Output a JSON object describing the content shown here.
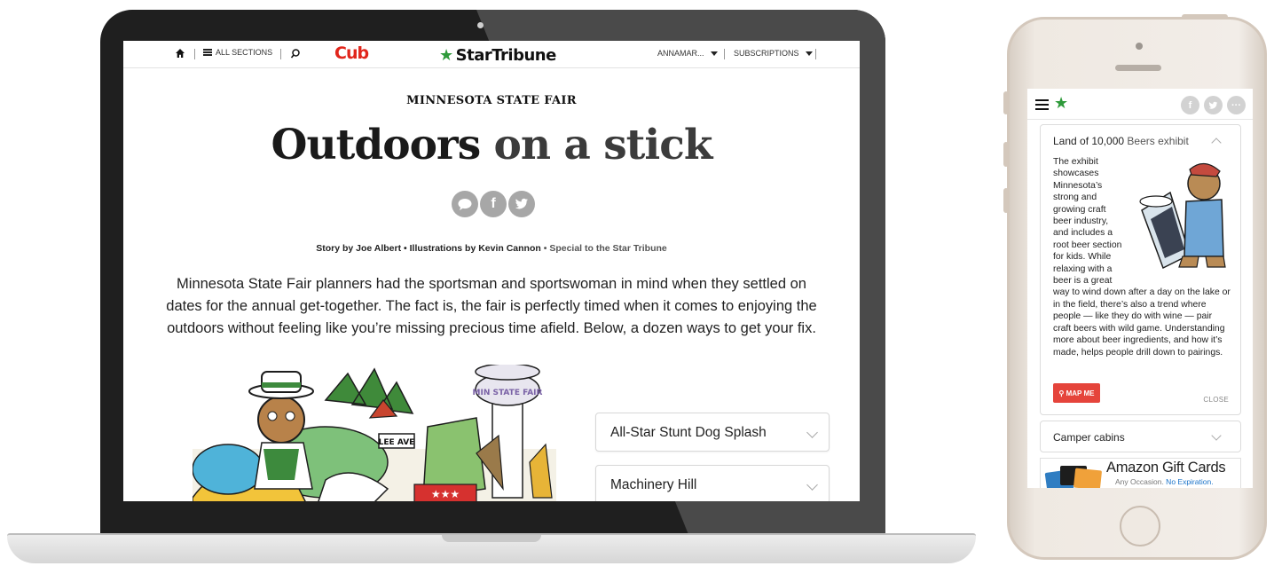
{
  "desktop": {
    "topbar": {
      "all_sections": "ALL SECTIONS",
      "sponsor": "Cub",
      "brand": "StarTribune",
      "account": "ANNAMAR...",
      "subscriptions": "SUBSCRIPTIONS"
    },
    "article": {
      "kicker": "MINNESOTA STATE FAIR",
      "headline_a": "Outdoors",
      "headline_b": " on a stick",
      "byline": "Story by Joe Albert • Illustrations by Kevin Cannon",
      "byline_suffix": " • Special to the Star Tribune",
      "lede": "Minnesota State Fair planners had the sportsman and sportswoman in mind when they settled on dates for the annual get-together. The fact is, the fair is perfectly timed when it comes to enjoying the outdoors without feeling like you’re missing precious time afield. Below, a dozen ways to get your fix.",
      "illustration_sign": "MIN STATE FAIR",
      "illustration_street": "LEE AVE"
    },
    "accordion": [
      {
        "label": "All-Star Stunt Dog Splash"
      },
      {
        "label": "Machinery Hill"
      }
    ]
  },
  "mobile": {
    "card": {
      "title_a": "Land of 10,000",
      "title_b": " Beers exhibit",
      "body": "The exhibit showcases Minnesota’s strong and growing craft beer industry, and includes a root beer section for kids. While relaxing with a beer is a great way to wind down after a day on the lake or in the field, there’s also a trend where people — like they do with wine — pair craft beers with wild game. Understanding more about beer ingredients, and how it’s made, helps people drill down to pairings.",
      "map_button": "MAP ME",
      "close": "CLOSE"
    },
    "card2": {
      "label": "Camper cabins"
    },
    "ad": {
      "title": "Amazon Gift Cards",
      "sub_a": "Any Occasion.",
      "sub_b": " No Expiration."
    }
  },
  "colors": {
    "brand_green": "#2e9a3a",
    "sponsor_red": "#e1251b",
    "map_button": "#e5443b",
    "share_gray": "#a7a7a7"
  }
}
